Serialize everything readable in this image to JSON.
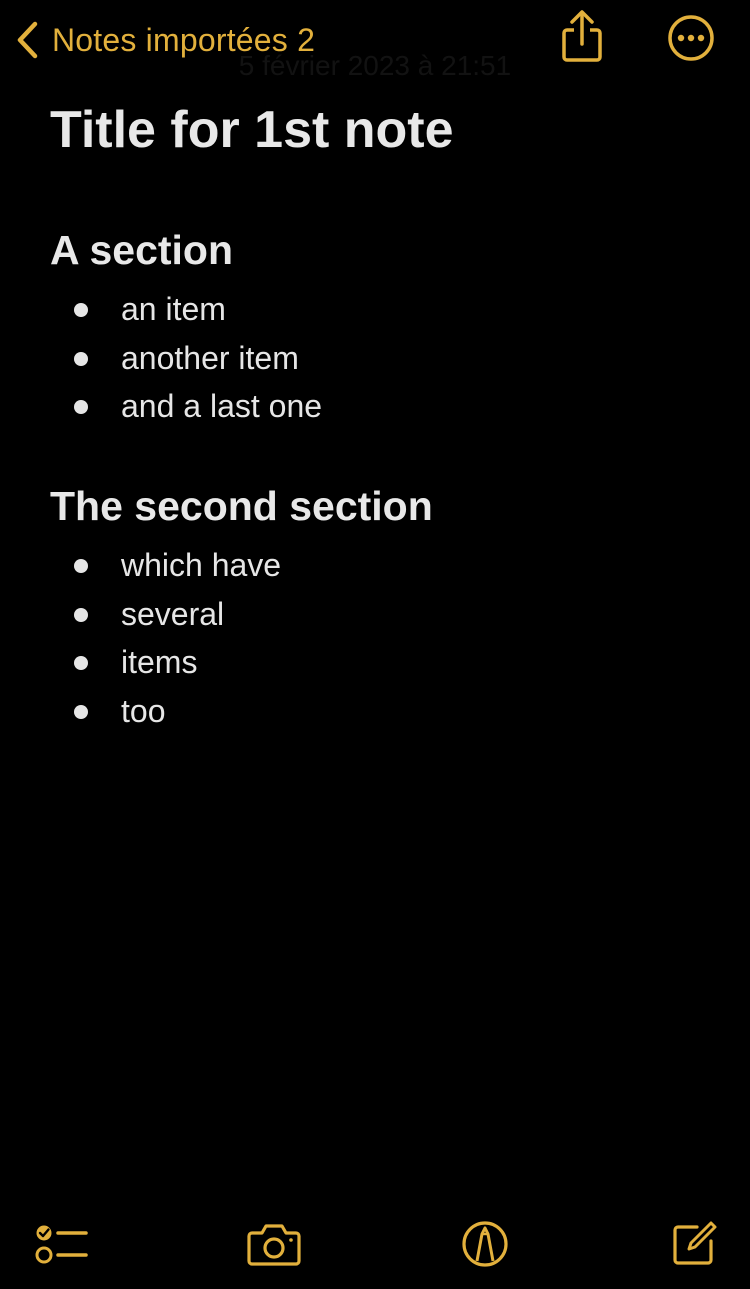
{
  "nav": {
    "back_label": "Notes importées 2",
    "date": "5 février 2023 à 21:51"
  },
  "note": {
    "title": "Title for 1st note",
    "sections": [
      {
        "heading": "A section",
        "items": [
          "an item",
          "another item",
          "and a last one"
        ]
      },
      {
        "heading": "The second section",
        "items": [
          "which have",
          "several",
          "items",
          "too"
        ]
      }
    ]
  },
  "icons": {
    "back": "chevron-left-icon",
    "share": "share-icon",
    "more": "ellipsis-circle-icon",
    "checklist": "checklist-icon",
    "camera": "camera-icon",
    "markup": "markup-pen-icon",
    "compose": "compose-icon"
  },
  "colors": {
    "accent": "#e2b03c",
    "background": "#000000",
    "text": "#e6e6e6"
  }
}
